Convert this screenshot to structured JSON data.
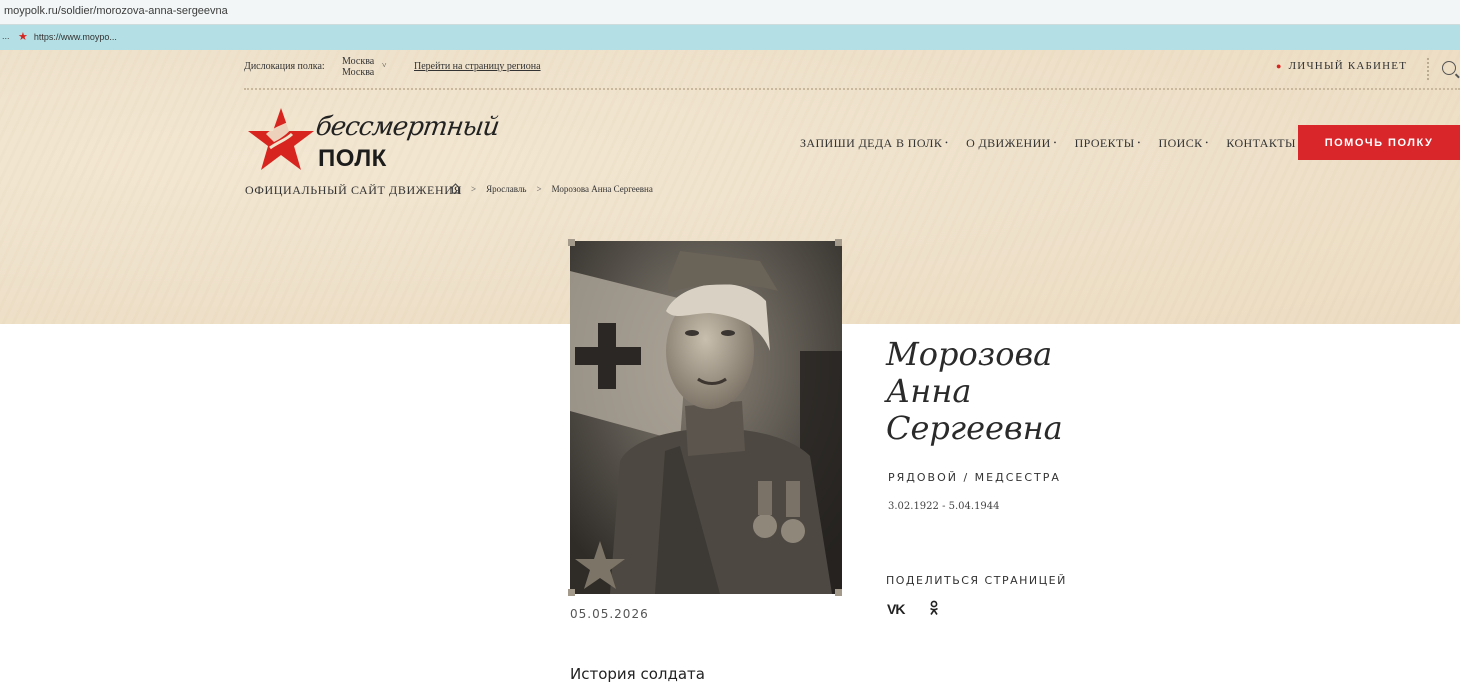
{
  "browser": {
    "url": "moypolk.ru/soldier/morozova-anna-sergeevna",
    "bookmark_leading": "...",
    "bookmark_label": "https://www.moypo..."
  },
  "header": {
    "dislocation_label": "Дислокация полка:",
    "city_line1": "Москва",
    "city_line2": "Москва",
    "city_chevron": "˅",
    "region_link": "Перейти на страницу региона",
    "cabinet_label": "ЛИЧНЫЙ КАБИНЕТ",
    "logo_script": "бессмертный",
    "logo_polk": "ПОЛК",
    "tagline": "ОФИЦИАЛЬНЫЙ САЙТ ДВИЖЕНИЯ",
    "nav": [
      {
        "label": "ЗАПИШИ ДЕДА В ПОЛК",
        "dropdown": true
      },
      {
        "label": "О ДВИЖЕНИИ",
        "dropdown": true
      },
      {
        "label": "ПРОЕКТЫ",
        "dropdown": true
      },
      {
        "label": "ПОИСК",
        "dropdown": true
      },
      {
        "label": "КОНТАКТЫ",
        "dropdown": false
      }
    ],
    "help_button": "ПОМОЧЬ ПОЛКУ",
    "colors": {
      "accent": "#d8262b",
      "hero_bg": "#efe2cc"
    }
  },
  "breadcrumb": {
    "items": [
      "Ярославль",
      "Морозова Анна Сергеевна"
    ],
    "separator": ">"
  },
  "soldier": {
    "name_line1": "Морозова",
    "name_line2": "Анна",
    "name_line3": "Сергеевна",
    "rank": "РЯДОВОЙ / МЕДСЕСТРА",
    "dates": "3.02.1922 - 5.04.1944",
    "photo_date": "05.05.2026",
    "share_label": "ПОДЕЛИТЬСЯ СТРАНИЦЕЙ",
    "history_heading": "История солдата",
    "share_icons": [
      "vk-icon",
      "odnoklassniki-icon"
    ],
    "vk_text": "VK"
  }
}
